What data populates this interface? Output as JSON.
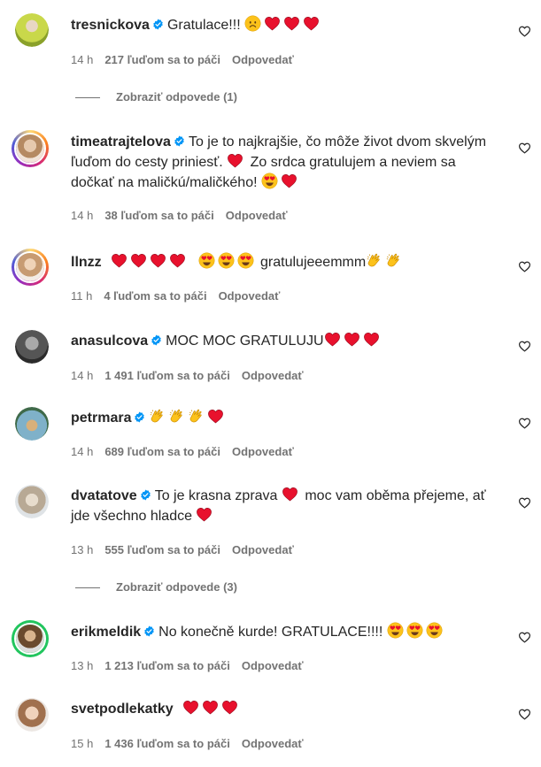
{
  "comments": [
    {
      "username": "tresnickova",
      "verified": true,
      "text": "Gratulace!!!",
      "emojis": [
        "sad-face",
        "heart",
        "heart",
        "heart"
      ],
      "time": "14 h",
      "likes": "217 ľuďom sa to páči",
      "reply": "Odpovedať"
    },
    {
      "username": "timeatrajtelova",
      "verified": true,
      "text": "To je to najkrajšie, čo môže život dvom skvelým ľuďom do cesty priniesť.",
      "text2": "Zo srdca gratulujem a neviem sa dočkať na maličkú/maličkého!",
      "time": "14 h",
      "likes": "38 ľuďom sa to páči",
      "reply": "Odpovedať"
    },
    {
      "username": "llnzz",
      "verified": false,
      "text": "gratulujeeemmm",
      "time": "11 h",
      "likes": "4 ľuďom sa to páči",
      "reply": "Odpovedať"
    },
    {
      "username": "anasulcova",
      "verified": true,
      "text": "MOC MOC GRATULUJU",
      "time": "14 h",
      "likes": "1 491 ľuďom sa to páči",
      "reply": "Odpovedať"
    },
    {
      "username": "petrmara",
      "verified": true,
      "text": "",
      "time": "14 h",
      "likes": "689 ľuďom sa to páči",
      "reply": "Odpovedať"
    },
    {
      "username": "dvatatove",
      "verified": true,
      "text": "To je krasna zprava",
      "text2": "moc vam oběma přejeme, ať jde všechno hladce",
      "time": "13 h",
      "likes": "555 ľuďom sa to páči",
      "reply": "Odpovedať"
    },
    {
      "username": "erikmeldik",
      "verified": true,
      "text": "No konečně kurde! GRATULACE!!!!",
      "time": "13 h",
      "likes": "1 213 ľuďom sa to páči",
      "reply": "Odpovedať"
    },
    {
      "username": "svetpodlekatky",
      "verified": false,
      "text": "",
      "time": "15 h",
      "likes": "1 436 ľuďom sa to páči",
      "reply": "Odpovedať"
    }
  ],
  "view_replies": [
    "Zobraziť odpovede (1)",
    "Zobraziť odpovede (3)"
  ],
  "colors": {
    "heart": "#e8112d",
    "verified": "#0095f6",
    "meta": "#737373"
  }
}
